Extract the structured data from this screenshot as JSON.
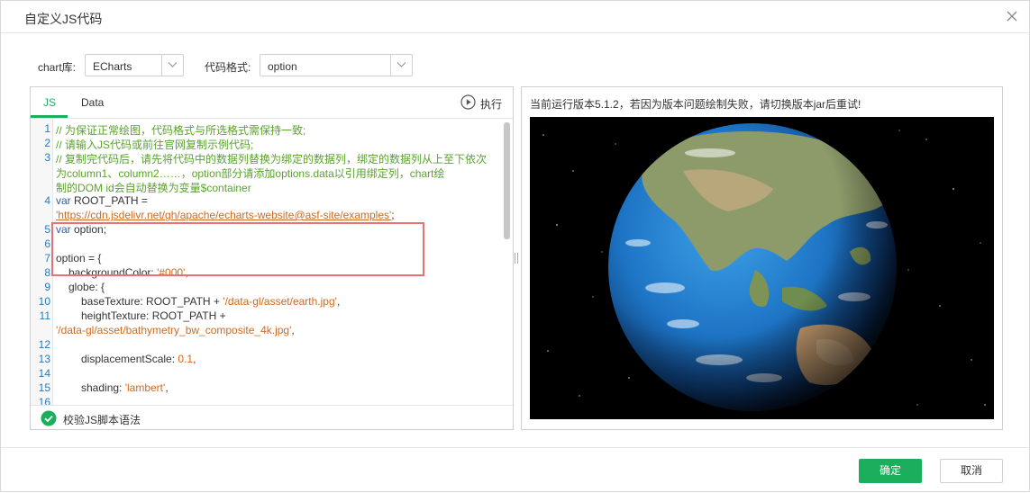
{
  "dialog": {
    "title": "自定义JS代码"
  },
  "options": {
    "chart_lib_label": "chart库:",
    "chart_lib_value": "ECharts",
    "code_format_label": "代码格式:",
    "code_format_value": "option"
  },
  "editor": {
    "tabs": [
      "JS",
      "Data"
    ],
    "active_tab": "JS",
    "run_label": "执行",
    "line_numbers": [
      "1",
      "2",
      "3",
      "4",
      "5",
      "6",
      "7",
      "8",
      "9",
      "10",
      "11",
      "12",
      "13",
      "14",
      "15",
      "16"
    ],
    "code": {
      "c1": "// 为保证正常绘图，代码格式与所选格式需保持一致;",
      "c2": "// 请输入JS代码或前往官网复制示例代码;",
      "c3a": "// 复制完代码后，请先将代码中的数据列替换为绑定的数据列，绑定的数据列从上至下依次",
      "c3b": "为column1、column2……，option部分请添加options.data以引用绑定列，chart绘",
      "c3c": "制的DOM id会自动替换为变量$container",
      "c4a_kw": "var",
      "c4a_rest": " ROOT_PATH =",
      "c4b_url": "'https://cdn.jsdelivr.net/gh/apache/echarts-website@asf-site/examples'",
      "c4b_end": ";",
      "c5_kw": "var",
      "c5_rest": " option;",
      "c7": "option = {",
      "c8_key": "backgroundColor: ",
      "c8_val": "'#000'",
      "c8_end": ",",
      "c9": "globe: {",
      "c10_key": "baseTexture: ROOT_PATH + ",
      "c10_val": "'/data-gl/asset/earth.jpg'",
      "c10_end": ",",
      "c11a": "heightTexture: ROOT_PATH +",
      "c11b_val": "'/data-gl/asset/bathymetry_bw_composite_4k.jpg'",
      "c11b_end": ",",
      "c13_key": "displacementScale: ",
      "c13_val": "0.1",
      "c13_end": ",",
      "c15_key": "shading: ",
      "c15_val": "'lambert'",
      "c15_end": ","
    },
    "status_text": "校验JS脚本语法"
  },
  "preview": {
    "note": "当前运行版本5.1.2，若因为版本问题绘制失败，请切换版本jar后重试!"
  },
  "footer": {
    "ok_label": "确定",
    "cancel_label": "取消"
  },
  "colors": {
    "accent": "#1bae5c",
    "highlight_border": "#e57373",
    "comment": "#5aa32c",
    "keyword": "#2a5fb0",
    "string": "#d2691e"
  }
}
